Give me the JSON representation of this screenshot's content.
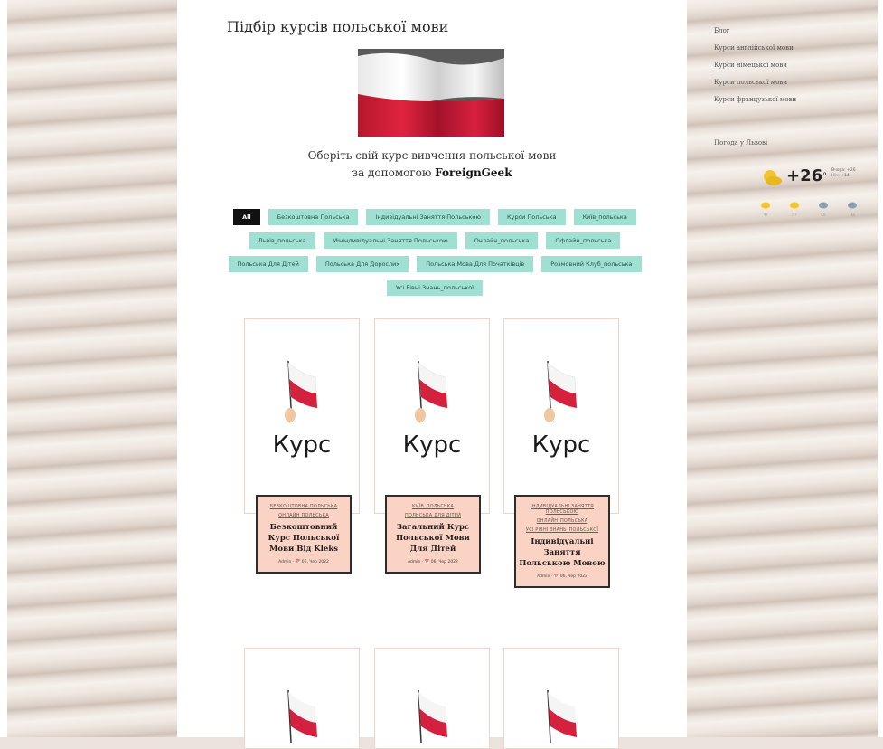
{
  "page": {
    "title": "Підбір курсів польської мови",
    "subtitle_line1": "Оберіть свій курс вивчення польської мови",
    "subtitle_line2_prefix": "за допомогою",
    "subtitle_brand": "ForeignGeek"
  },
  "filters": [
    {
      "label": "All",
      "active": true
    },
    {
      "label": "Безкоштовна Польська"
    },
    {
      "label": "Індивідуальні Заняття Польською"
    },
    {
      "label": "Курси Польська"
    },
    {
      "label": "Київ_польська"
    },
    {
      "label": "Львів_польська"
    },
    {
      "label": "Мініндивідуальні Заняття Польською"
    },
    {
      "label": "Онлайн_польська"
    },
    {
      "label": "Офлайн_польська"
    },
    {
      "label": "Польська Для Дітей"
    },
    {
      "label": "Польська Для Дорослих"
    },
    {
      "label": "Польська Мова Для Початківців"
    },
    {
      "label": "Розмовний Клуб_польська"
    },
    {
      "label": "Усі Рівні Знань_польської"
    }
  ],
  "cards": [
    {
      "image_label": "Курс",
      "categories": [
        "БЕЗКОШТОВНА ПОЛЬСЬКА",
        "ОНЛАЙН ПОЛЬСЬКА"
      ],
      "title": "Безкоштовний Курс Польської Мови Від Kleks",
      "meta": "Admin · 📅 06, Чер 2022"
    },
    {
      "image_label": "Курс",
      "categories": [
        "КИЇВ_ПОЛЬСЬКА",
        "ПОЛЬСЬКА ДЛЯ ДІТЕЙ"
      ],
      "title": "Загальний Курс Польської Мови Для Дітей",
      "meta": "Admin · 📅 06, Чер 2022"
    },
    {
      "image_label": "Курс",
      "categories": [
        "ІНДИВІДУАЛЬНІ ЗАНЯТТЯ ПОЛЬСЬКОЮ",
        "ОНЛАЙН_ПОЛЬСЬКА",
        "УСІ РІВНІ ЗНАНЬ_ПОЛЬСЬКОЇ"
      ],
      "title": "Індивідуальні Заняття Польською Мовою",
      "meta": "Admin · 📅 06, Чер 2022"
    }
  ],
  "sidebar": {
    "links": [
      "Блог",
      "Курси англійської мови",
      "Курси німецької мови",
      "Курси польської мови",
      "Курси французької мови"
    ],
    "weather_title": "Погода у Львові",
    "temp": "+26",
    "unit": "°",
    "minmax": [
      "Вчора: +26",
      "Ніч: +14"
    ],
    "forecast": [
      "Чт",
      "Пт",
      "Сб",
      "Нд"
    ]
  },
  "colors": {
    "chip": "#9fe0d2",
    "chip_active": "#111111",
    "card_info": "#fbd3c4",
    "flag_red": "#d4213d"
  }
}
